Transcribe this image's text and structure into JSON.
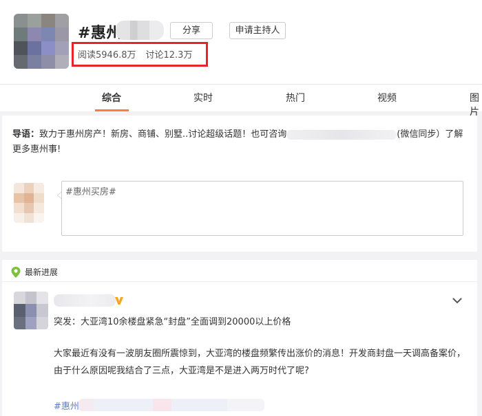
{
  "header": {
    "topic_title": "#惠州",
    "share_label": "分享",
    "apply_host_label": "申请主持人",
    "stats": {
      "reads": "阅读5946.8万",
      "discussions": "讨论12.3万"
    }
  },
  "tabs": [
    {
      "label": "综合",
      "active": true
    },
    {
      "label": "实时",
      "active": false
    },
    {
      "label": "热门",
      "active": false
    },
    {
      "label": "视频",
      "active": false
    },
    {
      "label": "图片",
      "active": false
    }
  ],
  "guide": {
    "label": "导语：",
    "text_before": "致力于惠州房产！新房、商铺、别墅..讨论超级话题！也可咨询",
    "text_after": "(微信同步）了解更多惠州事!"
  },
  "composer": {
    "value": "#惠州买房#"
  },
  "latest": {
    "label": "最新进展"
  },
  "post": {
    "headline": "突发：大亚湾10余楼盘紧急“封盘”全面调到20000以上价格",
    "body": "大家最近有没有一波朋友圈所震惊到，大亚湾的楼盘频繁传出涨价的消息！开发商封盘一天调高备案价，由于什么原因呢我结合了三点，大亚湾是不是进入两万时代了呢?",
    "tag": "#惠州"
  },
  "colors": {
    "accent": "#fa7d3c",
    "highlight_box": "#e8232a",
    "link": "#5c7dcb",
    "vip": "#f5a623",
    "pin": "#7cc13c"
  }
}
